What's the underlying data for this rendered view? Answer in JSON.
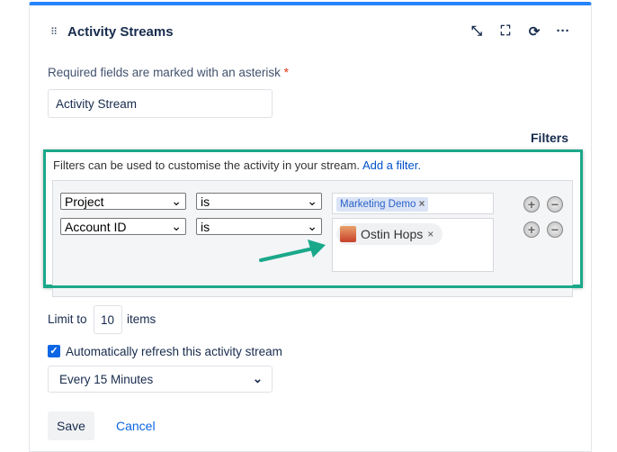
{
  "header": {
    "title": "Activity Streams",
    "icons": [
      "drag-handle-icon",
      "minimize-icon",
      "fullscreen-icon",
      "refresh-icon",
      "more-icon"
    ]
  },
  "form": {
    "required_note": "Required fields are marked with an asterisk",
    "asterisk": "*",
    "title_value": "Activity Stream",
    "filters_heading": "Filters",
    "filters_desc": "Filters can be used to customise the activity in your stream.",
    "add_filter": "Add a filter.",
    "filters": [
      {
        "field": "Project",
        "operator": "is",
        "value": "Marketing Demo"
      },
      {
        "field": "Account ID",
        "operator": "is",
        "value": "Ostin Hops"
      }
    ],
    "limit_prefix": "Limit to",
    "limit_value": "10",
    "limit_suffix": "items",
    "auto_refresh_label": "Automatically refresh this activity stream",
    "auto_refresh_checked": true,
    "refresh_interval": "Every 15 Minutes",
    "save": "Save",
    "cancel": "Cancel"
  },
  "colors": {
    "accent": "#2684ff",
    "highlight": "#1aa88a",
    "link": "#0052cc"
  }
}
